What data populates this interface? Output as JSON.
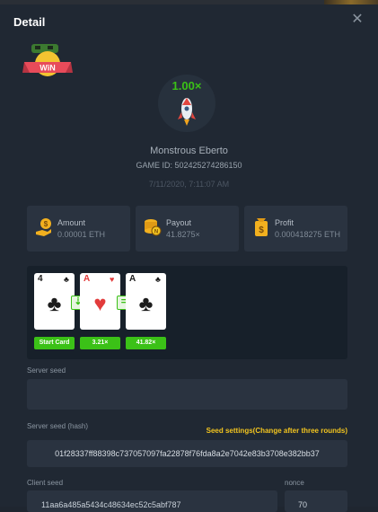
{
  "window": {
    "title": "Detail"
  },
  "badge": {
    "text": "WiN"
  },
  "game": {
    "multiplier": "1.00×",
    "player": "Monstrous Eberto",
    "game_id": "GAME ID: 502425274286150",
    "date": "7/11/2020, 7:11:07 AM"
  },
  "stats": [
    {
      "label": "Amount",
      "value": "0.00001 ETH",
      "icon": "money-hand-icon"
    },
    {
      "label": "Payout",
      "value": "41.8275×",
      "icon": "coin-stack-icon"
    },
    {
      "label": "Profit",
      "value": "0.000418275 ETH",
      "icon": "money-bag-icon"
    }
  ],
  "cards": [
    {
      "rank": "4",
      "suit": "♣",
      "color": "#1c1c1c"
    },
    {
      "rank": "A",
      "suit": "♥",
      "color": "#e23b3b"
    },
    {
      "rank": "A",
      "suit": "♣",
      "color": "#1c1c1c"
    }
  ],
  "connectors": [
    "⇣",
    "="
  ],
  "card_labels": [
    "Start Card",
    "3.21×",
    "41.82×"
  ],
  "colors": {
    "accent": "#3bc117",
    "gold": "#f2c41f",
    "panel": "#202833",
    "box": "#2a3340"
  },
  "seeds": {
    "server_seed_label": "Server seed",
    "server_seed_value": "",
    "server_hash_label": "Server seed (hash)",
    "seed_settings": "Seed settings(Change after three rounds)",
    "server_hash": "01f28337ff88398c737057097fa22878f76fda8a2e7042e83b3708e382bb37",
    "client_seed_label": "Client seed",
    "client_seed": "11aa6a485a5434c48634ec52c5abf787",
    "nonce_label": "nonce",
    "nonce": "70"
  }
}
